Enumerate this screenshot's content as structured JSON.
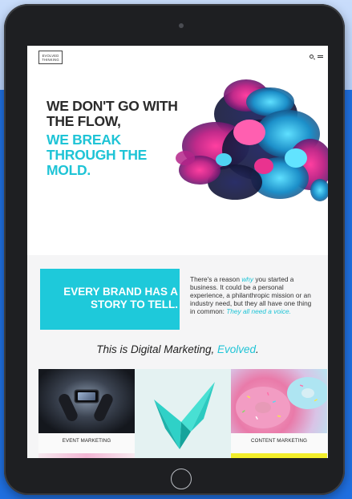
{
  "logo": {
    "line1": "EVOLVED",
    "line2": "THINKING"
  },
  "hero": {
    "line1": "WE DON'T GO WITH",
    "line2": "THE FLOW,",
    "accent1": "WE BREAK",
    "accent2": "THROUGH THE",
    "accent3": "MOLD."
  },
  "story": {
    "line1": "EVERY BRAND HAS A",
    "line2": "STORY TO TELL.",
    "intro_pre": "There's a reason ",
    "intro_why": "why",
    "intro_mid": " you started a business. It could be a personal experience, a philanthropic mission or an industry need, but they all have one thing in common: ",
    "intro_voice": "They all need a voice."
  },
  "tagline": {
    "text": "This is Digital Marketing, ",
    "accent": "Evolved",
    "end": "."
  },
  "cards": [
    {
      "label": "EVENT MARKETING"
    },
    {
      "label": "CONTENT MARKETING"
    }
  ],
  "colors": {
    "accent": "#1fc4d6",
    "cyan_box": "#1ec9da",
    "backdrop": "#1f6fe0",
    "device": "#1e1f22"
  },
  "icons": [
    "search-icon",
    "menu-icon",
    "camera-icon",
    "home-button"
  ]
}
